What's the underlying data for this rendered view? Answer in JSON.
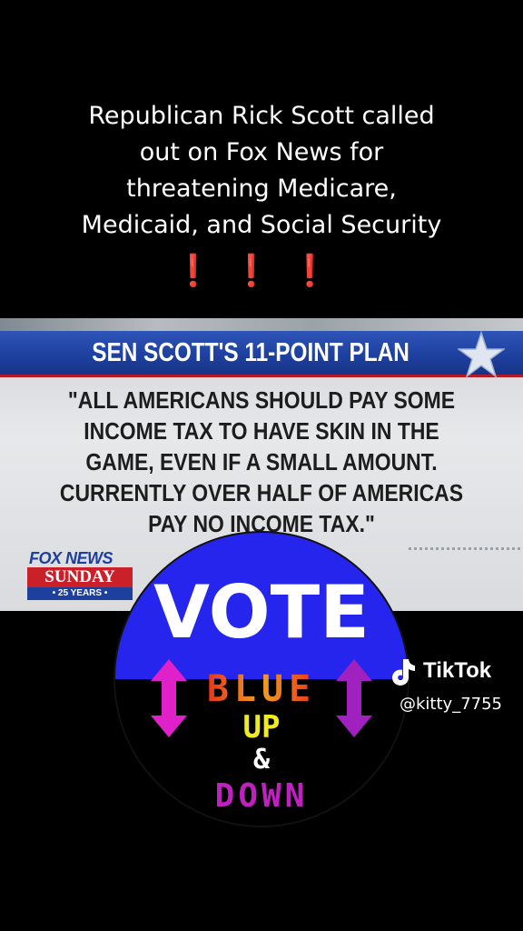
{
  "caption": {
    "lines": [
      "Republican Rick Scott called",
      "out on Fox News for",
      "threatening Medicare,",
      "Medicaid, and Social Security"
    ],
    "emphasis": "❗❗❗"
  },
  "broadcast": {
    "banner_title": "SEN SCOTT'S 11-POINT PLAN",
    "quote_lines": [
      "\"ALL AMERICANS SHOULD PAY SOME",
      "INCOME TAX TO HAVE SKIN IN THE",
      "GAME, EVEN IF A SMALL AMOUNT.",
      "CURRENTLY OVER HALF OF AMERICAS",
      "PAY NO INCOME TAX.\""
    ],
    "logo": {
      "line1": "FOX NEWS",
      "line2": "SUNDAY",
      "line3": "• 25 YEARS •"
    },
    "colors": {
      "banner_blue": "#1d3f9e",
      "accent_red": "#c9202a"
    }
  },
  "badge": {
    "word_vote": "VOTE",
    "word_blue": "BLUE",
    "word_up": "UP",
    "word_and": "&",
    "word_down": "DOWN",
    "colors": {
      "top": "#2222ee",
      "bottom": "#000000",
      "arrows": "#e020c8",
      "arrow_right": "#a020c0"
    }
  },
  "watermark": {
    "brand": "TikTok",
    "handle": "@kitty_7755",
    "icon": "tiktok-note-icon"
  }
}
